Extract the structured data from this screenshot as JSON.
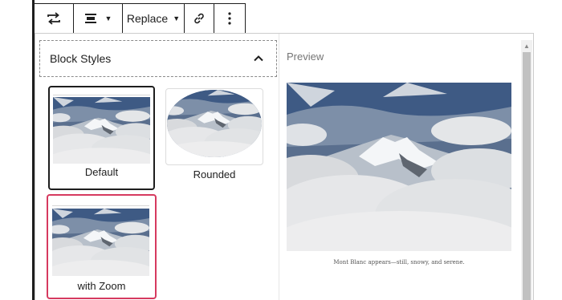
{
  "toolbar": {
    "transform_icon": "arrows-loop-icon",
    "align_icon": "align-center-icon",
    "replace_label": "Replace",
    "link_icon": "link-icon",
    "more_icon": "vertical-ellipsis-icon"
  },
  "panel": {
    "title": "Block Styles",
    "styles": [
      {
        "label": "Default",
        "selected": true
      },
      {
        "label": "Rounded",
        "selected": false
      },
      {
        "label": "with Zoom",
        "selected": false,
        "hover": true
      }
    ]
  },
  "preview": {
    "label": "Preview",
    "caption": "Mont Blanc appears—still, snowy, and serene."
  },
  "colors": {
    "border_dark": "#1e1e1e",
    "hover_outline": "#d63a5f",
    "sky": "#3c5a86",
    "cloud": "#e8e8e8"
  }
}
